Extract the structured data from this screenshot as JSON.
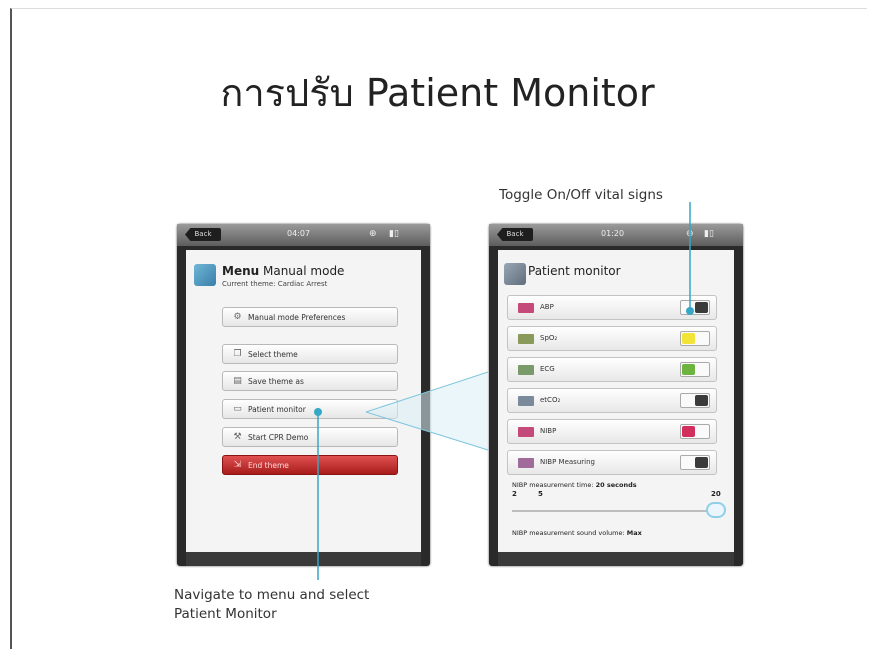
{
  "slide": {
    "title": "การปรับ Patient Monitor",
    "callout_top": "Toggle On/Off vital signs",
    "callout_bottom_line1": "Navigate to menu and select",
    "callout_bottom_line2": "Patient Monitor"
  },
  "left_device": {
    "back_label": "Back",
    "clock": "04:07",
    "menu_title_bold": "Menu",
    "menu_title_rest": " Manual mode",
    "menu_subtitle": "Current theme: Cardiac Arrest",
    "buttons": [
      {
        "label": "Manual mode Preferences",
        "icon": "gear-icon"
      },
      {
        "label": "Select theme",
        "icon": "copy-icon"
      },
      {
        "label": "Save theme as",
        "icon": "save-icon"
      },
      {
        "label": "Patient monitor",
        "icon": "monitor-icon"
      },
      {
        "label": "Start CPR Demo",
        "icon": "wrench-icon"
      },
      {
        "label": "End theme",
        "icon": "exit-icon"
      }
    ]
  },
  "right_device": {
    "back_label": "Back",
    "clock": "01:20",
    "title": "Patient monitor",
    "vitals": [
      {
        "label": "ABP",
        "state": "off",
        "icon_color": "#c44a7a",
        "on_color": ""
      },
      {
        "label": "SpO₂",
        "state": "on",
        "icon_color": "#8a9a5a",
        "on_color": "#f2e437"
      },
      {
        "label": "ECG",
        "state": "on",
        "icon_color": "#7a9a6a",
        "on_color": "#6db33f"
      },
      {
        "label": "etCO₂",
        "state": "off",
        "icon_color": "#7a8a9a",
        "on_color": ""
      },
      {
        "label": "NIBP",
        "state": "on",
        "icon_color": "#c44a7a",
        "on_color": "#d32f5c"
      },
      {
        "label": "NIBP Measuring",
        "state": "off",
        "icon_color": "#a06a9a",
        "on_color": ""
      }
    ],
    "nibp_time_label": "NIBP measurement time:",
    "nibp_time_value": "20 seconds",
    "tick_min": "2",
    "tick_a": "5",
    "tick_max": "20",
    "nibp_volume_label": "NIBP measurement sound volume:",
    "nibp_volume_value": "Max"
  }
}
